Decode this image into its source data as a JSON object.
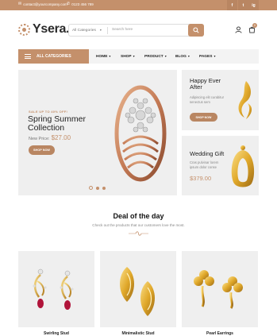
{
  "topbar": {
    "email": "contact@yourcompany.com",
    "phone": "0123 456 789",
    "social": [
      "f",
      "t",
      "ig"
    ]
  },
  "header": {
    "logo": "Ysera.",
    "search": {
      "category": "All Categories",
      "placeholder": "Search here"
    },
    "cart_count": "0"
  },
  "nav": {
    "all_categories": "ALL CATEGORIES",
    "items": [
      {
        "label": "HOME"
      },
      {
        "label": "SHOP"
      },
      {
        "label": "PRODUCT"
      },
      {
        "label": "BLOG"
      },
      {
        "label": "PAGES"
      }
    ]
  },
  "hero": {
    "eyebrow": "SALE UP TO 40% OFF!",
    "title": "Spring Summer Collection",
    "price_label": "New Price:",
    "price": "$27.00",
    "button": "SHOP NOW",
    "slides": 3,
    "active_slide": 1
  },
  "banners": [
    {
      "title": "Happy Ever After",
      "desc": "Adipiscing elit curabitur senectus sem",
      "button": "SHOP NOW"
    },
    {
      "title": "Wedding Gift",
      "desc": "Cras pulvinar lorem ipsum dolor conse",
      "price": "$379.00"
    }
  ],
  "deal": {
    "title": "Deal of the day",
    "subtitle": "Check out the products that our customers love the most."
  },
  "products": [
    {
      "name": "Swirling Stud"
    },
    {
      "name": "Minimalistic Stud"
    },
    {
      "name": "Pearl Earrings"
    }
  ],
  "colors": {
    "accent": "#c4906b",
    "gold": "#e0a82a",
    "panel": "#efefef"
  }
}
